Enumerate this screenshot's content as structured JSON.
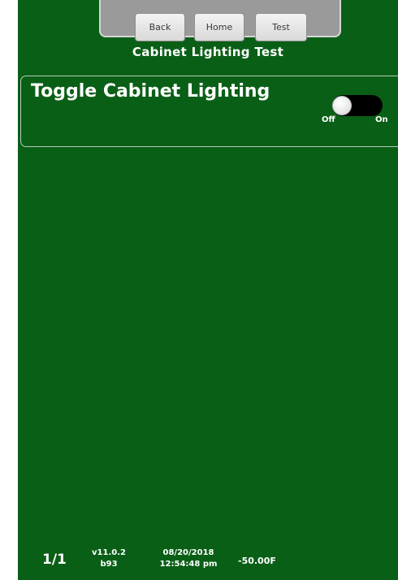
{
  "nav": {
    "back_label": "Back",
    "home_label": "Home",
    "test_label": "Test"
  },
  "page": {
    "title": "Cabinet Lighting Test"
  },
  "setting": {
    "label": "Toggle Cabinet Lighting",
    "toggle": {
      "state": "off",
      "off_label": "Off",
      "on_label": "On"
    }
  },
  "footer": {
    "page_indicator": "1/1",
    "version": "v11.0.2",
    "build": "b93",
    "date": "08/20/2018",
    "time": "12:54:48 pm",
    "temperature": "-50.00F"
  },
  "colors": {
    "background": "#0a5f17",
    "text": "#ffffff",
    "nav_tray": "#9a9a9a"
  }
}
